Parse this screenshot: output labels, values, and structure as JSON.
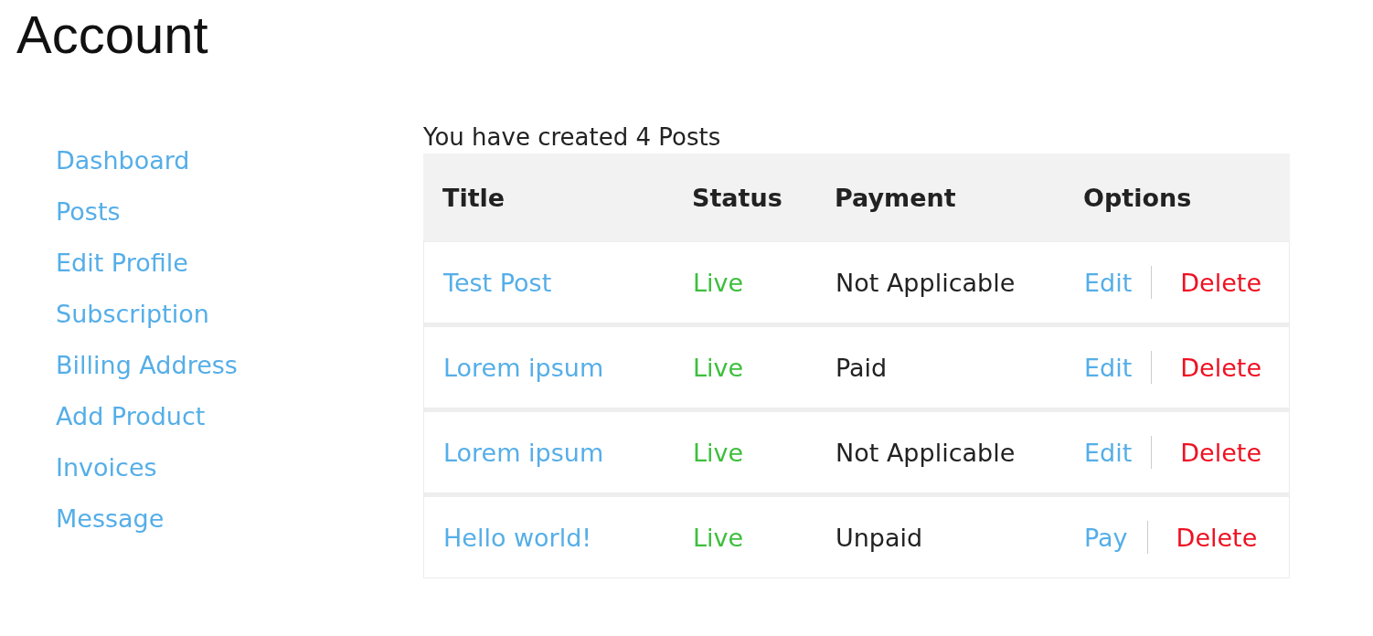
{
  "page": {
    "title": "Account"
  },
  "sidebar": {
    "items": [
      {
        "label": "Dashboard"
      },
      {
        "label": "Posts"
      },
      {
        "label": "Edit Profile"
      },
      {
        "label": "Subscription"
      },
      {
        "label": "Billing Address"
      },
      {
        "label": "Add Product"
      },
      {
        "label": "Invoices"
      },
      {
        "label": "Message"
      }
    ]
  },
  "summary": "You have created 4 Posts",
  "table": {
    "columns": [
      "Title",
      "Status",
      "Payment",
      "Options"
    ],
    "rows": [
      {
        "title": "Test Post",
        "status": "Live",
        "payment": "Not Applicable",
        "options": [
          {
            "label": "Edit",
            "kind": "action"
          },
          {
            "label": "Delete",
            "kind": "danger"
          }
        ]
      },
      {
        "title": "Lorem ipsum",
        "status": "Live",
        "payment": "Paid",
        "options": [
          {
            "label": "Edit",
            "kind": "action"
          },
          {
            "label": "Delete",
            "kind": "danger"
          }
        ]
      },
      {
        "title": "Lorem ipsum",
        "status": "Live",
        "payment": "Not Applicable",
        "options": [
          {
            "label": "Edit",
            "kind": "action"
          },
          {
            "label": "Delete",
            "kind": "danger"
          }
        ]
      },
      {
        "title": "Hello world!",
        "status": "Live",
        "payment": "Unpaid",
        "options": [
          {
            "label": "Pay",
            "kind": "action"
          },
          {
            "label": "Delete",
            "kind": "danger"
          }
        ]
      }
    ]
  }
}
